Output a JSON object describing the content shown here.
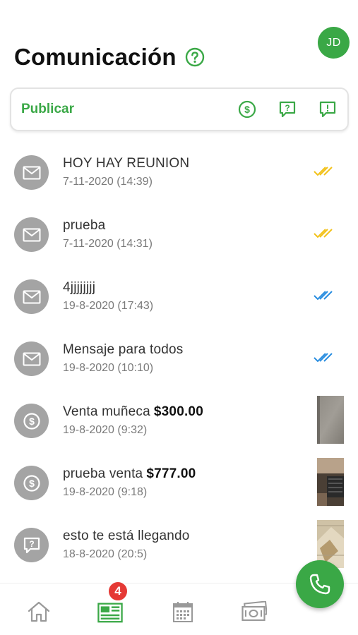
{
  "header": {
    "title": "Comunicación",
    "avatar_initials": "JD",
    "help_icon": "question-circle-icon"
  },
  "publish": {
    "label": "Publicar",
    "actions": [
      {
        "icon": "dollar-circle-icon"
      },
      {
        "icon": "question-message-icon"
      },
      {
        "icon": "alert-message-icon"
      }
    ]
  },
  "messages": [
    {
      "icon": "mail-icon",
      "title": "HOY HAY REUNION",
      "date": "7-11-2020 (14:39)",
      "status": "delivered",
      "status_color": "#f2c21b"
    },
    {
      "icon": "mail-icon",
      "title": "prueba",
      "date": "7-11-2020 (14:31)",
      "status": "delivered",
      "status_color": "#f2c21b"
    },
    {
      "icon": "mail-icon",
      "title": "4jjjjjjjj",
      "date": "19-8-2020 (17:43)",
      "status": "read",
      "status_color": "#2a8ee0"
    },
    {
      "icon": "mail-icon",
      "title": "Mensaje para todos",
      "date": "19-8-2020 (10:10)",
      "status": "read",
      "status_color": "#2a8ee0"
    },
    {
      "icon": "dollar-circle-icon",
      "title": "Venta muñeca",
      "amount": "$300.00",
      "date": "19-8-2020 (9:32)",
      "thumbnail": "photo-thumbnail"
    },
    {
      "icon": "dollar-circle-icon",
      "title": "prueba venta",
      "amount": "$777.00",
      "date": "19-8-2020 (9:18)",
      "thumbnail": "photo-thumbnail"
    },
    {
      "icon": "question-message-icon",
      "title": "esto te está llegando",
      "date": "18-8-2020 (20:5)",
      "thumbnail": "photo-thumbnail"
    }
  ],
  "bottom_nav": {
    "items": [
      {
        "icon": "home-icon"
      },
      {
        "icon": "newsfeed-icon",
        "badge": "4",
        "active": true
      },
      {
        "icon": "calendar-icon"
      },
      {
        "icon": "money-icon"
      }
    ]
  },
  "fab": {
    "icon": "phone-icon"
  },
  "colors": {
    "accent": "#3aa846",
    "badge": "#e53935"
  }
}
